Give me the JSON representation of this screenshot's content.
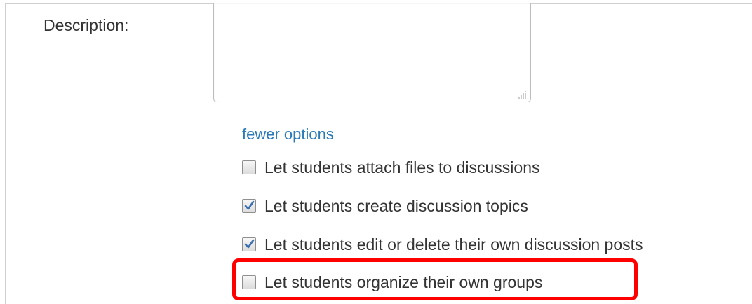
{
  "form": {
    "description_label": "Description:",
    "description_value": ""
  },
  "options_link": "fewer options",
  "options": [
    {
      "label": "Let students attach files to discussions",
      "checked": false
    },
    {
      "label": "Let students create discussion topics",
      "checked": true
    },
    {
      "label": "Let students edit or delete their own discussion posts",
      "checked": true
    },
    {
      "label": "Let students organize their own groups",
      "checked": false
    }
  ],
  "colors": {
    "link": "#2a7ab8",
    "highlight": "#ff0000",
    "check": "#3a6fb0"
  }
}
